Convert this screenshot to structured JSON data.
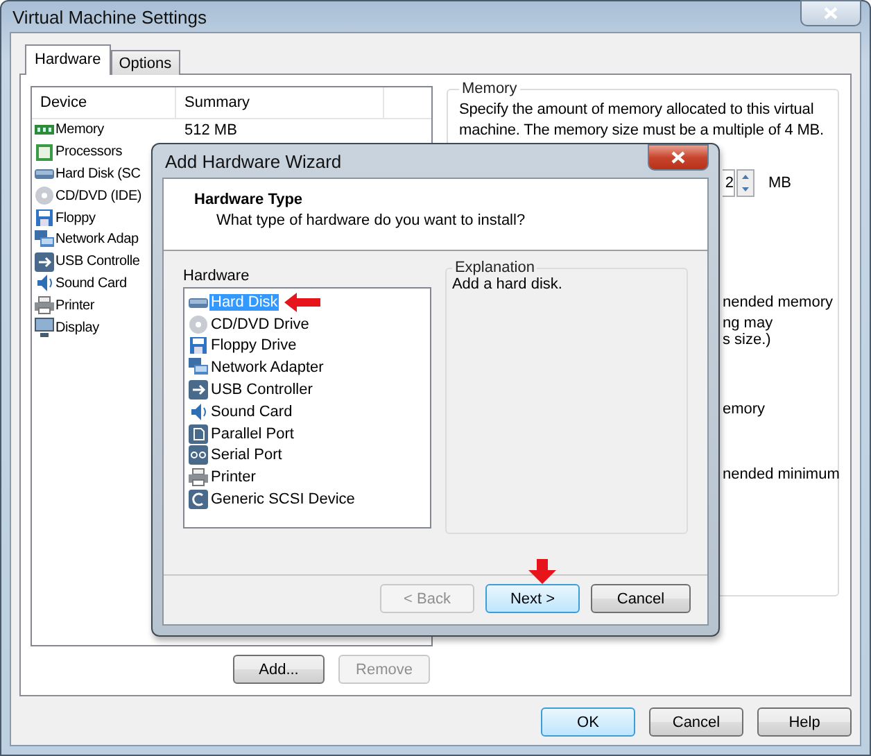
{
  "window": {
    "title": "Virtual Machine Settings"
  },
  "tabs": [
    {
      "label": "Hardware",
      "selected": true
    },
    {
      "label": "Options",
      "selected": false
    }
  ],
  "device_table": {
    "columns": [
      "Device",
      "Summary"
    ],
    "rows": [
      {
        "kind": "memory",
        "device": "Memory",
        "summary": "512 MB"
      },
      {
        "kind": "processor",
        "device": "Processors"
      },
      {
        "kind": "disk",
        "device": "Hard Disk (SC"
      },
      {
        "kind": "disc",
        "device": "CD/DVD (IDE)"
      },
      {
        "kind": "floppy",
        "device": "Floppy"
      },
      {
        "kind": "network",
        "device": "Network Adap"
      },
      {
        "kind": "usb",
        "device": "USB Controlle"
      },
      {
        "kind": "sound",
        "device": "Sound Card"
      },
      {
        "kind": "printer",
        "device": "Printer"
      },
      {
        "kind": "display",
        "device": "Display"
      }
    ]
  },
  "device_buttons": [
    {
      "label": "Add...",
      "disabled": false
    },
    {
      "label": "Remove",
      "disabled": true
    }
  ],
  "memory_group": {
    "title": "Memory",
    "description": "Specify the amount of memory allocated to this virtual machine. The memory size must be a multiple of 4 MB.",
    "value": "2",
    "unit": "MB",
    "fragments": [
      "nended memory",
      "ng may",
      "s size.)",
      "emory",
      "nended minimum"
    ]
  },
  "dialog_buttons": [
    {
      "label": "OK",
      "default": true
    },
    {
      "label": "Cancel",
      "default": false
    },
    {
      "label": "Help",
      "default": false
    }
  ],
  "wizard": {
    "title": "Add Hardware Wizard",
    "heading": "Hardware Type",
    "subheading": "What type of hardware do you want to install?",
    "list_label": "Hardware",
    "items": [
      {
        "kind": "disk",
        "label": "Hard Disk",
        "selected": true
      },
      {
        "kind": "disc",
        "label": "CD/DVD Drive",
        "selected": false
      },
      {
        "kind": "floppy",
        "label": "Floppy Drive",
        "selected": false
      },
      {
        "kind": "network",
        "label": "Network Adapter",
        "selected": false
      },
      {
        "kind": "usb",
        "label": "USB Controller",
        "selected": false
      },
      {
        "kind": "sound",
        "label": "Sound Card",
        "selected": false
      },
      {
        "kind": "parallel",
        "label": "Parallel Port",
        "selected": false
      },
      {
        "kind": "serial",
        "label": "Serial Port",
        "selected": false
      },
      {
        "kind": "printer",
        "label": "Printer",
        "selected": false
      },
      {
        "kind": "scsi",
        "label": "Generic SCSI Device",
        "selected": false
      }
    ],
    "explanation_title": "Explanation",
    "explanation": "Add a hard disk.",
    "buttons": [
      {
        "label": "< Back",
        "disabled": true,
        "default": false
      },
      {
        "label": "Next >",
        "disabled": false,
        "default": true
      },
      {
        "label": "Cancel",
        "disabled": false,
        "default": false
      }
    ]
  }
}
